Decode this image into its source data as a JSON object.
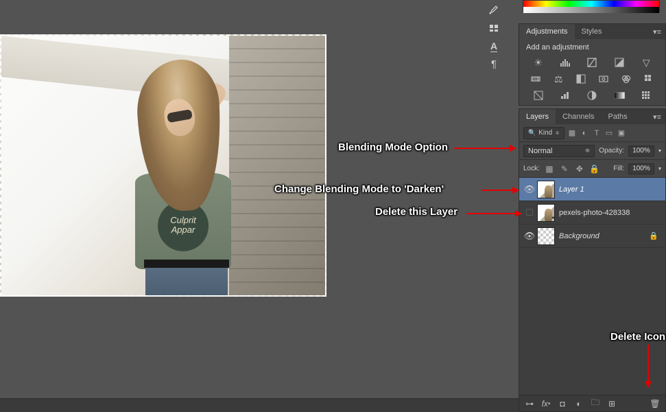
{
  "canvas": {
    "shirt_line1": "Culprit",
    "shirt_line2": "Appar"
  },
  "adjustments": {
    "tab_adjustments": "Adjustments",
    "tab_styles": "Styles",
    "subtitle": "Add an adjustment"
  },
  "layers_panel": {
    "tab_layers": "Layers",
    "tab_channels": "Channels",
    "tab_paths": "Paths",
    "filter_kind_label": "Kind",
    "blend_mode": "Normal",
    "opacity_label": "Opacity:",
    "opacity_value": "100%",
    "lock_label": "Lock:",
    "fill_label": "Fill:",
    "fill_value": "100%",
    "layers": [
      {
        "name": "Layer 1",
        "visible": true,
        "selected": true
      },
      {
        "name": "pexels-photo-428338",
        "visible": false,
        "selected": false
      },
      {
        "name": "Background",
        "visible": true,
        "selected": false,
        "locked": true,
        "italic": true
      }
    ]
  },
  "annotations": {
    "blend_option": "Blending Mode Option",
    "change_darken": "Change Blending Mode to 'Darken'",
    "delete_layer": "Delete this Layer",
    "delete_icon": "Delete Icon"
  }
}
